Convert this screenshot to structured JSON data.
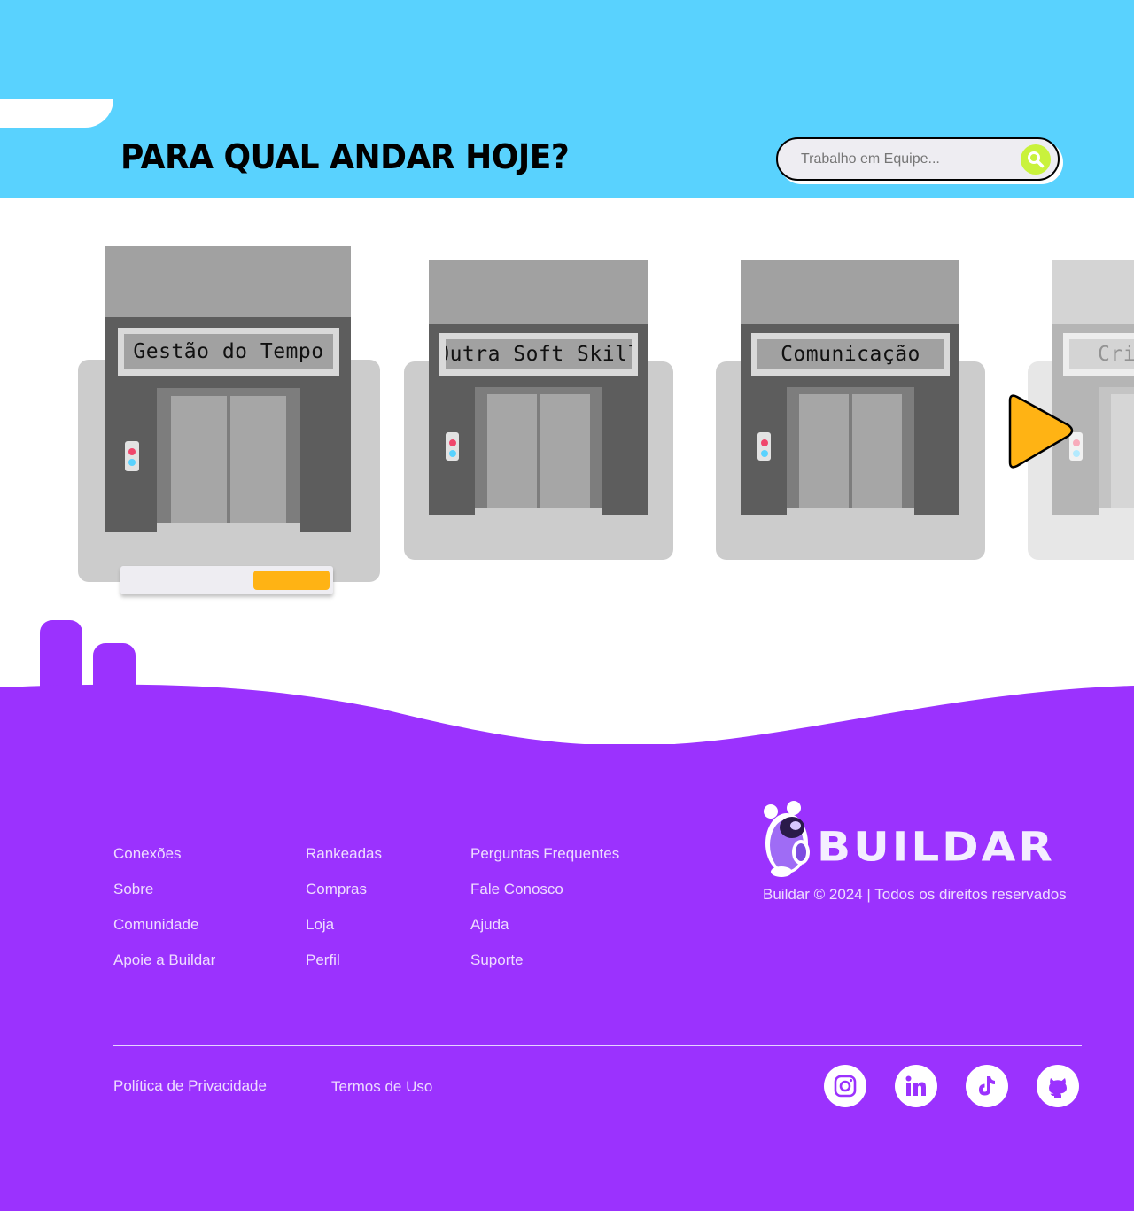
{
  "header": {
    "title": "PARA QUAL ANDAR HOJE?",
    "search_placeholder": "Trabalho em Equipe...",
    "search_icon": "search-icon"
  },
  "elevators": [
    {
      "label": "Gestão do Tempo",
      "selected": true,
      "progress": 0.37
    },
    {
      "label": "Outra Soft Skill",
      "selected": false
    },
    {
      "label": "Comunicação",
      "selected": false
    },
    {
      "label": "Cria",
      "selected": false,
      "partially_visible": true
    }
  ],
  "carousel": {
    "next_icon": "play-arrow-icon"
  },
  "footer": {
    "columns": [
      {
        "links": [
          "Conexões",
          "Sobre",
          "Comunidade",
          "Apoie a Buildar"
        ]
      },
      {
        "links": [
          "Rankeadas",
          "Compras",
          "Loja",
          "Perfil"
        ]
      },
      {
        "links": [
          "Perguntas Frequentes",
          "Fale Conosco",
          "Ajuda",
          "Suporte"
        ]
      }
    ],
    "brand": "BUILDAR",
    "copyright": "Buildar © 2024 | Todos os direitos reservados",
    "legal": {
      "privacy": "Política de Privacidade",
      "terms": "Termos de Uso"
    },
    "social": [
      "instagram-icon",
      "linkedin-icon",
      "tiktok-icon",
      "github-icon"
    ]
  },
  "colors": {
    "header_bg": "#59d2fe",
    "footer_bg": "#9b32fe",
    "accent_yellow": "#ffb314",
    "search_button": "#c9f23c"
  }
}
